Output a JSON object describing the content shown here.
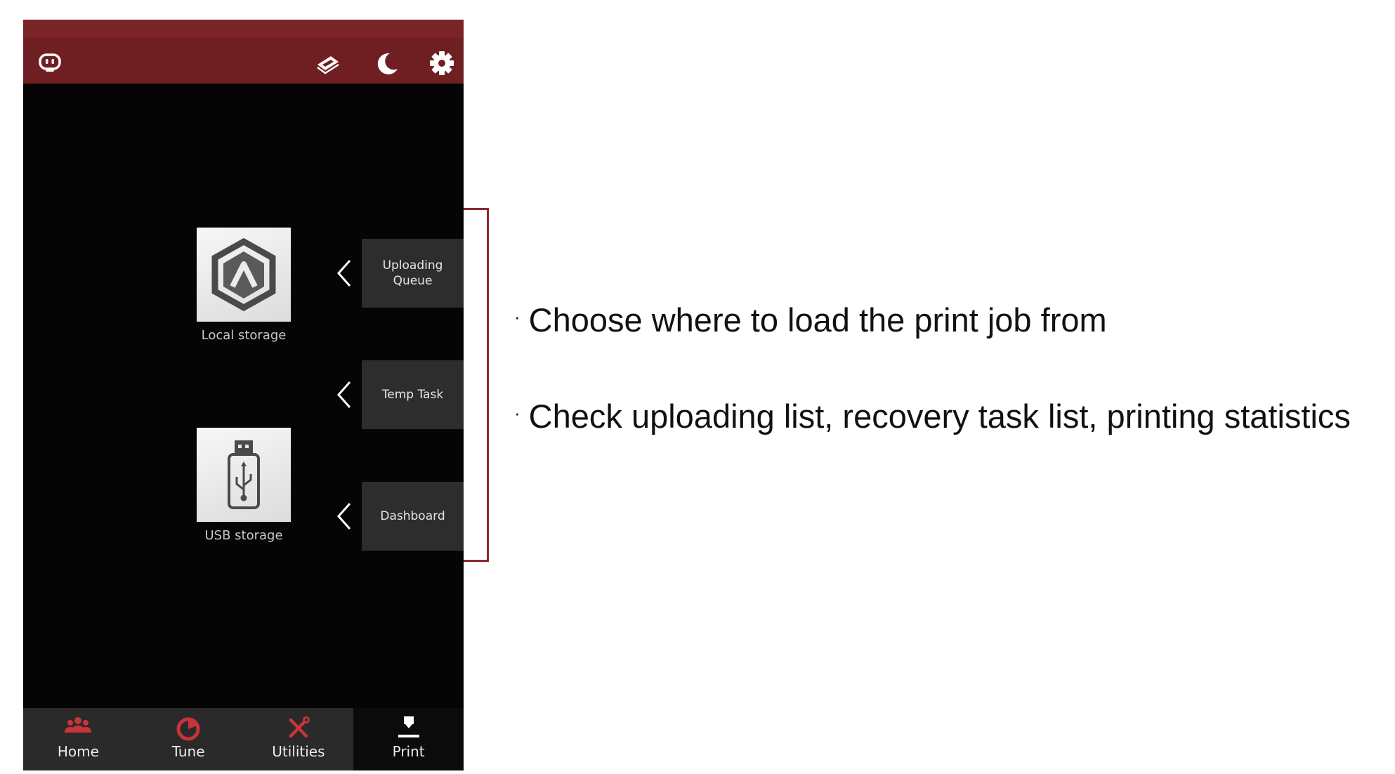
{
  "topbar": {
    "icons": [
      "robot-face-icon",
      "tray-icon",
      "moon-icon",
      "gear-icon"
    ]
  },
  "storage": {
    "local_label": "Local storage",
    "usb_label": "USB storage"
  },
  "side_buttons": [
    {
      "label": "Uploading\nQueue"
    },
    {
      "label": "Temp Task"
    },
    {
      "label": "Dashboard"
    }
  ],
  "nav": {
    "items": [
      {
        "label": "Home",
        "icon": "people-icon"
      },
      {
        "label": "Tune",
        "icon": "pie-icon"
      },
      {
        "label": "Utilities",
        "icon": "tools-icon"
      },
      {
        "label": "Print",
        "icon": "print-icon"
      }
    ],
    "active": "Print"
  },
  "notes": {
    "bullet": "·",
    "line1": "Choose where to load the print job from",
    "line2": "Check uploading list, recovery task list, printing statistics"
  },
  "colors": {
    "header": "#6f1f22",
    "accent_red": "#c8343a",
    "bracket": "#8e2a2e",
    "screen_bg": "#050505",
    "navbar": "#2a2a2a"
  }
}
